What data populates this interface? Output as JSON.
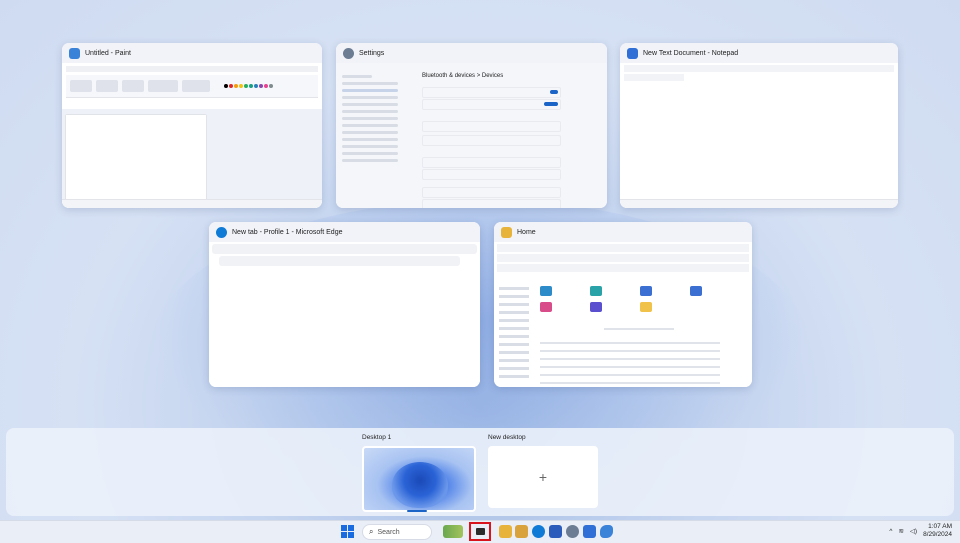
{
  "windows": {
    "paint": {
      "title": "Untitled - Paint",
      "color": "#3b82d9"
    },
    "settings": {
      "title": "Settings",
      "color": "#6b7c93",
      "heading": "Bluetooth & devices > Devices"
    },
    "notepad": {
      "title": "New Text Document - Notepad",
      "color": "#2f6fd6"
    },
    "edge": {
      "title": "New tab - Profile 1 - Microsoft Edge",
      "color": "#0f7bd7"
    },
    "explorer": {
      "title": "Home",
      "color": "#e8b33a"
    }
  },
  "desktops": [
    {
      "label": "Desktop 1"
    },
    {
      "label": "New desktop",
      "plus": "+"
    }
  ],
  "taskbar": {
    "search_placeholder": "Search",
    "search_icon": "⌕",
    "accent": "#1a64c8",
    "taskview_highlight": "#d8131b",
    "tray": {
      "chevron": "^",
      "wifi_icon": "wifi-icon",
      "volume_icon": "speaker-icon",
      "time": "1:07 AM",
      "date": "8/29/2024"
    }
  }
}
